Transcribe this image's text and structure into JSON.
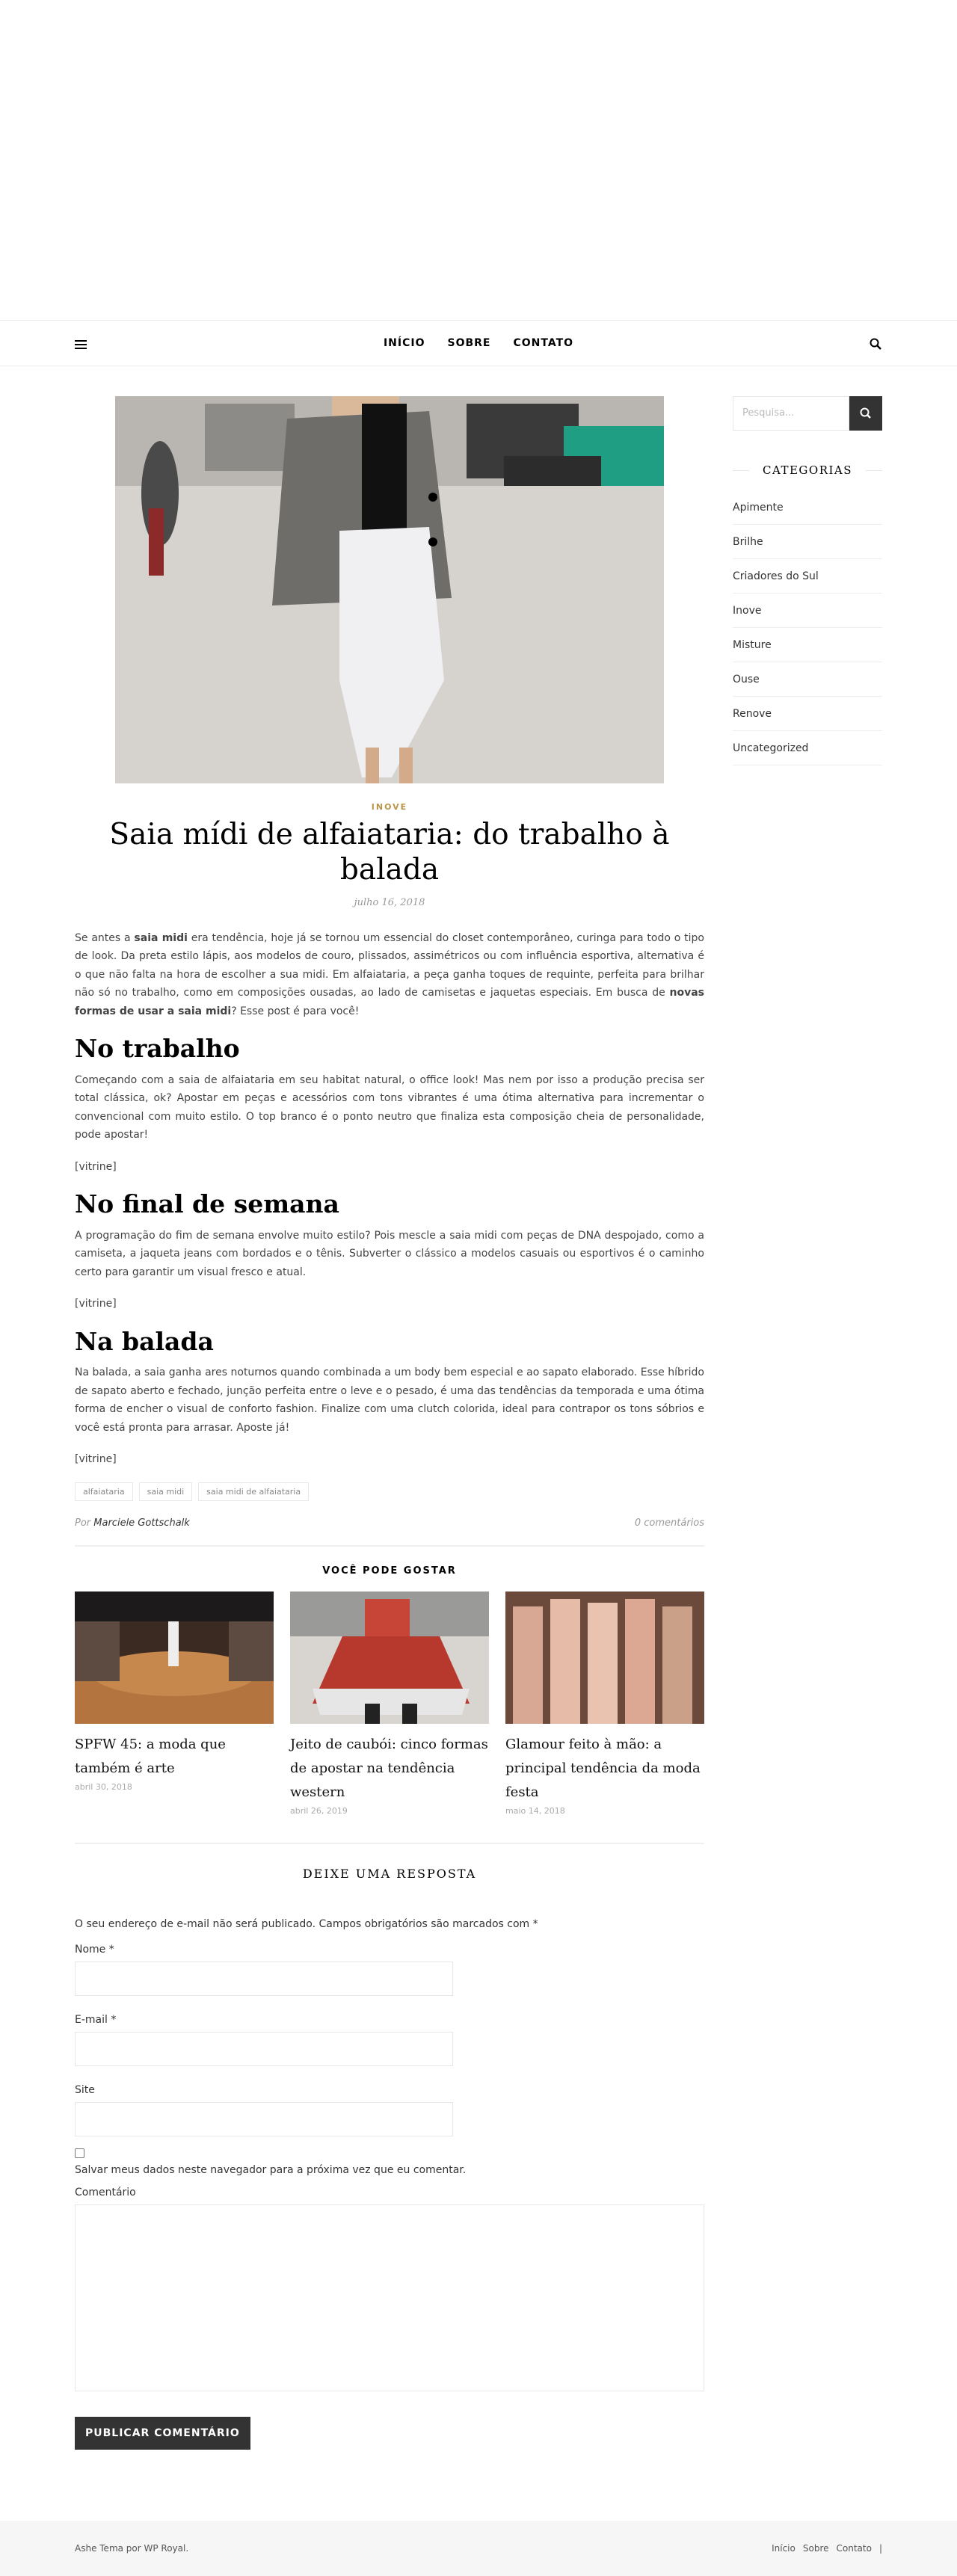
{
  "nav": {
    "items": [
      "INÍCIO",
      "SOBRE",
      "CONTATO"
    ]
  },
  "post": {
    "category": "INOVE",
    "title": "Saia mídi de alfaiataria: do trabalho à balada",
    "date": "julho 16, 2018",
    "intro": {
      "p1": "Se antes a ",
      "b1": "saia midi",
      "p2": " era tendência, hoje já se tornou um essencial do closet contemporâneo, curinga para todo o tipo de look. Da preta estilo lápis, aos modelos de couro, plissados, assimétricos ou com influência esportiva, alternativa é o que não falta na hora de escolher a sua midi. Em alfaiataria, a peça ganha toques de requinte, perfeita para brilhar não só no trabalho, como em composições ousadas, ao lado de camisetas e jaquetas especiais. Em busca de ",
      "b2": "novas formas de usar a saia midi",
      "p3": "? Esse post é para você!"
    },
    "sections": [
      {
        "heading": "No trabalho",
        "text": "Começando com a saia de alfaiataria em seu habitat natural, o office look! Mas nem por isso a produção precisa ser total clássica, ok? Apostar em peças e acessórios com tons vibrantes é uma ótima alternativa para incrementar o convencional com muito estilo. O top branco é o ponto neutro que finaliza esta composição cheia de personalidade, pode apostar!",
        "vitrine": "[vitrine]"
      },
      {
        "heading": "No final de semana",
        "text": "A programação do fim de semana envolve muito estilo? Pois mescle a saia midi com peças de DNA despojado, como a camiseta, a jaqueta jeans com bordados e o tênis. Subverter o clássico a modelos casuais ou esportivos é o caminho certo para garantir um visual fresco e atual.",
        "vitrine": "[vitrine]"
      },
      {
        "heading": "Na balada",
        "text": "Na balada, a saia ganha ares noturnos quando combinada a um body bem especial e ao sapato elaborado. Esse híbrido de sapato aberto e fechado, junção perfeita entre o leve e o pesado, é uma das tendências da temporada e uma ótima forma de encher o visual de conforto fashion. Finalize com uma clutch colorida, ideal para contrapor os tons sóbrios e você está pronta para arrasar. Aposte já!",
        "vitrine": "[vitrine]"
      }
    ],
    "tags": [
      "alfaiataria",
      "saia midi",
      "saia midi de alfaiataria"
    ],
    "author_prefix": "Por",
    "author": "Marciele Gottschalk",
    "comments": "0 comentários"
  },
  "related": {
    "title": "VOCÊ PODE GOSTAR",
    "items": [
      {
        "title": "SPFW 45: a moda que também é arte",
        "date": "abril 30, 2018"
      },
      {
        "title": "Jeito de caubói: cinco formas de apostar na tendência western",
        "date": "abril 26, 2019"
      },
      {
        "title": "Glamour feito à mão: a principal tendência da moda festa",
        "date": "maio 14, 2018"
      }
    ]
  },
  "reply": {
    "title": "DEIXE UMA RESPOSTA",
    "notice": "O seu endereço de e-mail não será publicado. Campos obrigatórios são marcados com *",
    "name_label": "Nome *",
    "email_label": "E-mail *",
    "site_label": "Site",
    "save_label": "Salvar meus dados neste navegador para a próxima vez que eu comentar.",
    "comment_label": "Comentário",
    "submit": "PUBLICAR COMENTÁRIO"
  },
  "sidebar": {
    "search_placeholder": "Pesquisa...",
    "categories_title": "CATEGORIAS",
    "categories": [
      "Apimente",
      "Brilhe",
      "Criadores do Sul",
      "Inove",
      "Misture",
      "Ouse",
      "Renove",
      "Uncategorized"
    ]
  },
  "footer": {
    "copyright": "Ashe Tema por WP Royal.",
    "links": [
      "Início",
      "Sobre",
      "Contato"
    ],
    "sep": "|"
  }
}
